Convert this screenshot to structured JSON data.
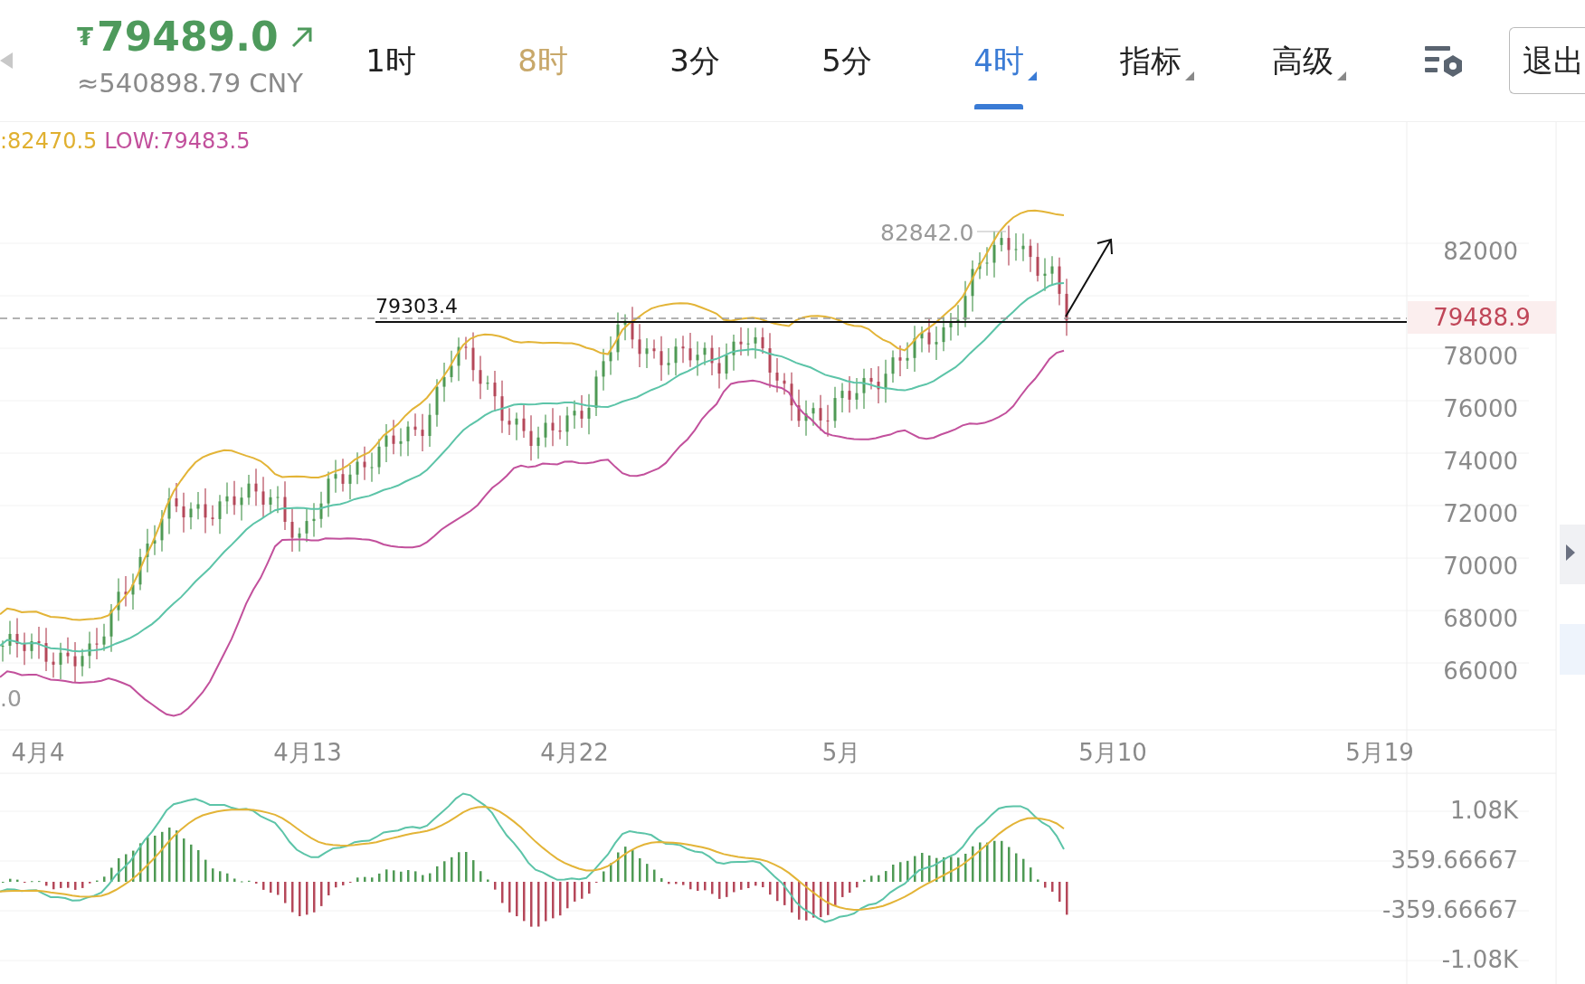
{
  "price": {
    "currency_sign": "₮",
    "value": "79489.0",
    "converted": "≈540898.79 CNY"
  },
  "tabs": [
    {
      "label": "1时",
      "selected": false,
      "highlighted": false,
      "has_menu": false
    },
    {
      "label": "8时",
      "selected": false,
      "highlighted": true,
      "has_menu": false
    },
    {
      "label": "3分",
      "selected": false,
      "highlighted": false,
      "has_menu": false
    },
    {
      "label": "5分",
      "selected": false,
      "highlighted": false,
      "has_menu": false
    },
    {
      "label": "4时",
      "selected": true,
      "highlighted": false,
      "has_menu": true
    },
    {
      "label": "指标",
      "selected": false,
      "highlighted": false,
      "has_menu": true
    },
    {
      "label": "高级",
      "selected": false,
      "highlighted": false,
      "has_menu": true
    }
  ],
  "exit_button": "退出",
  "stats": [
    {
      "text": ":82470.5",
      "color": "#e0b030"
    },
    {
      "text": "LOW:79483.5",
      "color": "#c2509c"
    }
  ],
  "price_axis": {
    "ticks": [
      "82000",
      "78000",
      "76000",
      "74000",
      "72000",
      "70000",
      "68000",
      "66000"
    ],
    "current_price": "79488.9"
  },
  "time_axis": [
    "4月4",
    "4月13",
    "4月22",
    "5月",
    "5月10",
    "5月19"
  ],
  "annotations": [
    {
      "kind": "peak",
      "text": "82842.0"
    },
    {
      "kind": "level",
      "text": "79303.4"
    },
    {
      "kind": "low",
      "text": ".0"
    }
  ],
  "macd_axis": [
    "1.08K",
    "359.66667",
    "-359.66667",
    "-1.08K"
  ]
}
